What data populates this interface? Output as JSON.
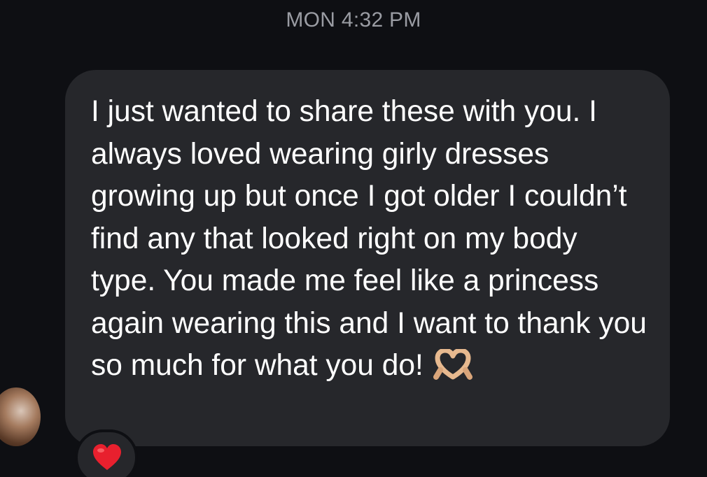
{
  "thread": {
    "timestamp": "MON 4:32 PM"
  },
  "message": {
    "text": "I just wanted to share these with you. I always loved wearing girly dresses growing up but once I got older I couldn’t find any that looked right on my body type. You made me feel like a princess again wearing this and I want to thank you so much for what you do!",
    "emoji_icon": "heart-hands-icon",
    "reaction_icon": "red-heart-icon"
  },
  "colors": {
    "background": "#0e0f13",
    "bubble": "#26272b",
    "text": "#ffffff",
    "timestamp": "#9a9ca3",
    "reaction_heart": "#e8202e"
  }
}
